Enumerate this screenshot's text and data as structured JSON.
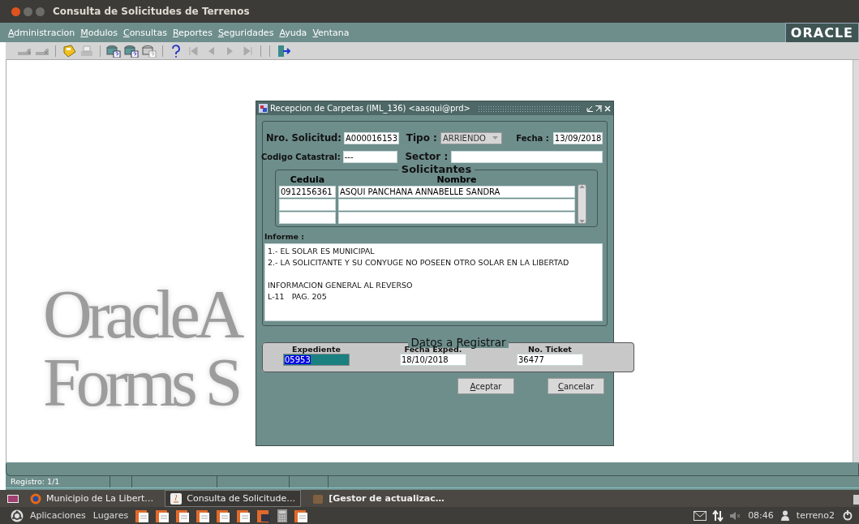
{
  "window": {
    "title": "Consulta de Solicitudes de Terrenos"
  },
  "menu": [
    "Administracion",
    "Modulos",
    "Consultas",
    "Reportes",
    "Seguridades",
    "Ayuda",
    "Ventana"
  ],
  "brand": "ORACLE",
  "toolbar": [
    {
      "kind": "insert",
      "disabled": true
    },
    {
      "kind": "delete",
      "disabled": true
    },
    {
      "kind": "sep"
    },
    {
      "kind": "save",
      "disabled": false
    },
    {
      "kind": "print",
      "disabled": true
    },
    {
      "kind": "sep"
    },
    {
      "kind": "query",
      "disabled": false
    },
    {
      "kind": "execute",
      "disabled": false
    },
    {
      "kind": "cancel",
      "disabled": true
    },
    {
      "kind": "sep"
    },
    {
      "kind": "help",
      "disabled": false
    },
    {
      "kind": "first",
      "disabled": true
    },
    {
      "kind": "prev",
      "disabled": true
    },
    {
      "kind": "next",
      "disabled": true
    },
    {
      "kind": "last",
      "disabled": true
    },
    {
      "kind": "sep"
    },
    {
      "kind": "sep"
    },
    {
      "kind": "exit",
      "disabled": false
    }
  ],
  "background_text": [
    "OracleA",
    "Forms S"
  ],
  "dialog": {
    "title": "Recepcion de Carpetas (IML_136) <aasqui@prd>",
    "nro_solicitud": {
      "label": "Nro. Solicitud:",
      "value": "A000016153"
    },
    "tipo": {
      "label": "Tipo :",
      "value": "ARRIENDO",
      "disabled": true
    },
    "fecha": {
      "label": "Fecha :",
      "value": "13/09/2018"
    },
    "codigo_catastral": {
      "label": "Codigo Catastral:",
      "value": "---"
    },
    "sector": {
      "label": "Sector :"
    },
    "solicitantes": {
      "title": "Solicitantes",
      "columns": [
        "Cedula",
        "Nombre"
      ],
      "rows": [
        [
          "0912156361",
          "ASQUI PANCHANA ANNABELLE SANDRA"
        ]
      ]
    },
    "informe": {
      "label": "Informe :",
      "paragraphs": [
        [
          "1.- EL SOLAR ES MUNICIPAL",
          "2.- LA SOLICITANTE Y SU CONYUGE NO POSEEN OTRO SOLAR EN LA LIBERTAD"
        ],
        [
          "INFORMACION GENERAL AL REVERSO",
          "L-11   PAG. 205"
        ]
      ]
    },
    "datos": {
      "title": "Datos a Registrar",
      "fields": [
        {
          "label": "Expediente",
          "value": "05953",
          "selected": true
        },
        {
          "label": "Fecha Exped.",
          "value": "18/10/2018",
          "selected": false
        },
        {
          "label": "No. Ticket",
          "value": "36477",
          "selected": false
        }
      ]
    },
    "buttons": [
      "Aceptar",
      "Cancelar"
    ]
  },
  "status_bar": {
    "record": "Registro: 1/1"
  },
  "taskbar": [
    {
      "kind": "browser",
      "label": "Municipio de La Libert…",
      "selected": false
    },
    {
      "kind": "java",
      "label": "Consulta de Solicitude…",
      "selected": true
    },
    {
      "kind": "package",
      "label": "[Gestor de actualizac…",
      "selected": false
    }
  ],
  "panel": {
    "menus": [
      "Aplicaciones",
      "Lugares"
    ],
    "clock": "08:46",
    "user": "terreno2",
    "volume_muted": true
  }
}
